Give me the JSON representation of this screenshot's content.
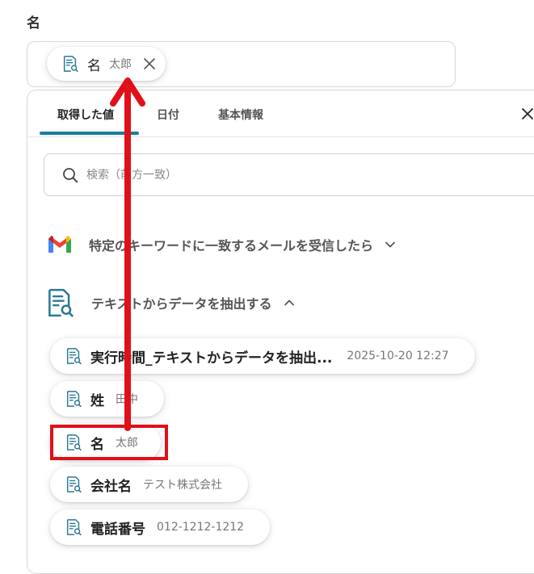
{
  "field": {
    "label": "名"
  },
  "selected_chip": {
    "name": "名",
    "value": "太郎"
  },
  "tabs": [
    {
      "label": "取得した値",
      "active": true
    },
    {
      "label": "日付",
      "active": false
    },
    {
      "label": "基本情報",
      "active": false
    }
  ],
  "search": {
    "placeholder": "検索（前方一致）"
  },
  "groups": [
    {
      "label": "特定のキーワードに一致するメールを受信したら",
      "icon": "gmail-icon",
      "expanded": false
    },
    {
      "label": "テキストからデータを抽出する",
      "icon": "document-search-icon",
      "expanded": true
    }
  ],
  "items": [
    {
      "name": "実行時間_テキストからデータを抽出...",
      "value": "2025-10-20 12:27"
    },
    {
      "name": "姓",
      "value": "田中"
    },
    {
      "name": "名",
      "value": "太郎"
    },
    {
      "name": "会社名",
      "value": "テスト株式会社"
    },
    {
      "name": "電話番号",
      "value": "012-1212-1212"
    }
  ],
  "colors": {
    "accent": "#1a7d9b",
    "highlight": "#e0101a",
    "icon": "#2a7a94"
  }
}
